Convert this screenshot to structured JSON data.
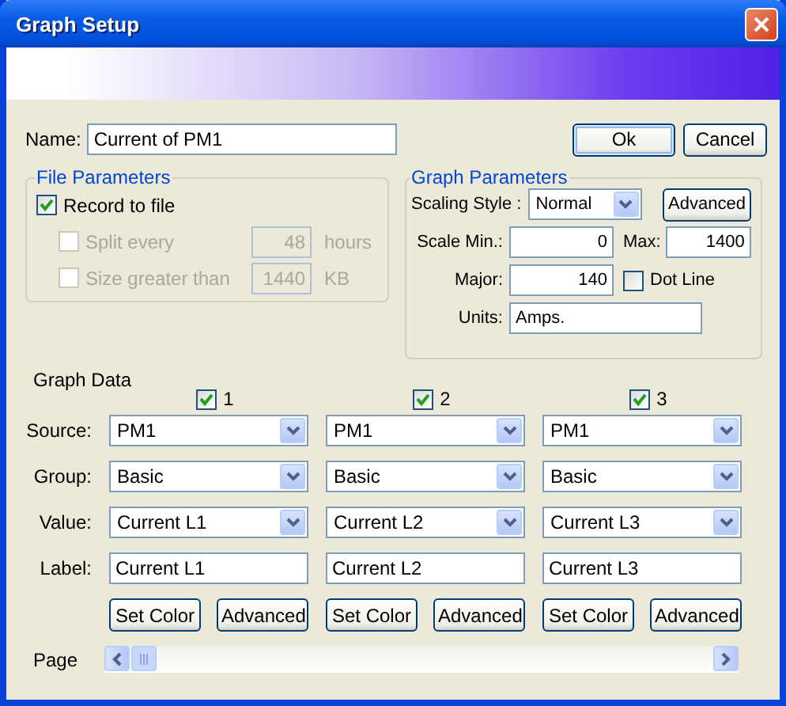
{
  "window": {
    "title": "Graph Setup"
  },
  "name_field": {
    "label": "Name:",
    "value": "Current of PM1"
  },
  "buttons": [
    {
      "label": "Ok",
      "default": true
    },
    {
      "label": "Cancel",
      "default": false
    }
  ],
  "file_parameters": {
    "title": "File Parameters",
    "options": [
      {
        "kind": "checkbox",
        "label": "Record to file",
        "checked": true,
        "disabled": false
      },
      {
        "kind": "checkbox_field",
        "label": "Split every",
        "checked": false,
        "disabled": true,
        "value": "48",
        "unit": "hours"
      },
      {
        "kind": "checkbox_field",
        "label": "Size greater than",
        "checked": false,
        "disabled": true,
        "value": "1440",
        "unit": "KB"
      }
    ]
  },
  "graph_parameters": {
    "title": "Graph Parameters",
    "scaling_style": {
      "label": "Scaling Style :",
      "value": "Normal"
    },
    "advanced_button": "Advanced",
    "min": {
      "label": "Scale  Min.:",
      "value": "0"
    },
    "max": {
      "label": "Max:",
      "value": "1400"
    },
    "major": {
      "label": "Major:",
      "value": "140"
    },
    "dot_line": {
      "label": "Dot Line",
      "checked": false
    },
    "units": {
      "label": "Units:",
      "value": "Amps."
    }
  },
  "graph_data": {
    "title": "Graph Data",
    "row_labels": [
      "Source:",
      "Group:",
      "Value:",
      "Label:"
    ],
    "series": [
      {
        "number": "1",
        "checked": true,
        "source": "PM1",
        "group": "Basic",
        "value": "Current L1",
        "label": "Current L1",
        "buttons": [
          "Set Color",
          "Advanced"
        ]
      },
      {
        "number": "2",
        "checked": true,
        "source": "PM1",
        "group": "Basic",
        "value": "Current L2",
        "label": "Current L2",
        "buttons": [
          "Set Color",
          "Advanced"
        ]
      },
      {
        "number": "3",
        "checked": true,
        "source": "PM1",
        "group": "Basic",
        "value": "Current L3",
        "label": "Current L3",
        "buttons": [
          "Set Color",
          "Advanced"
        ]
      }
    ]
  },
  "page": {
    "label": "Page"
  }
}
